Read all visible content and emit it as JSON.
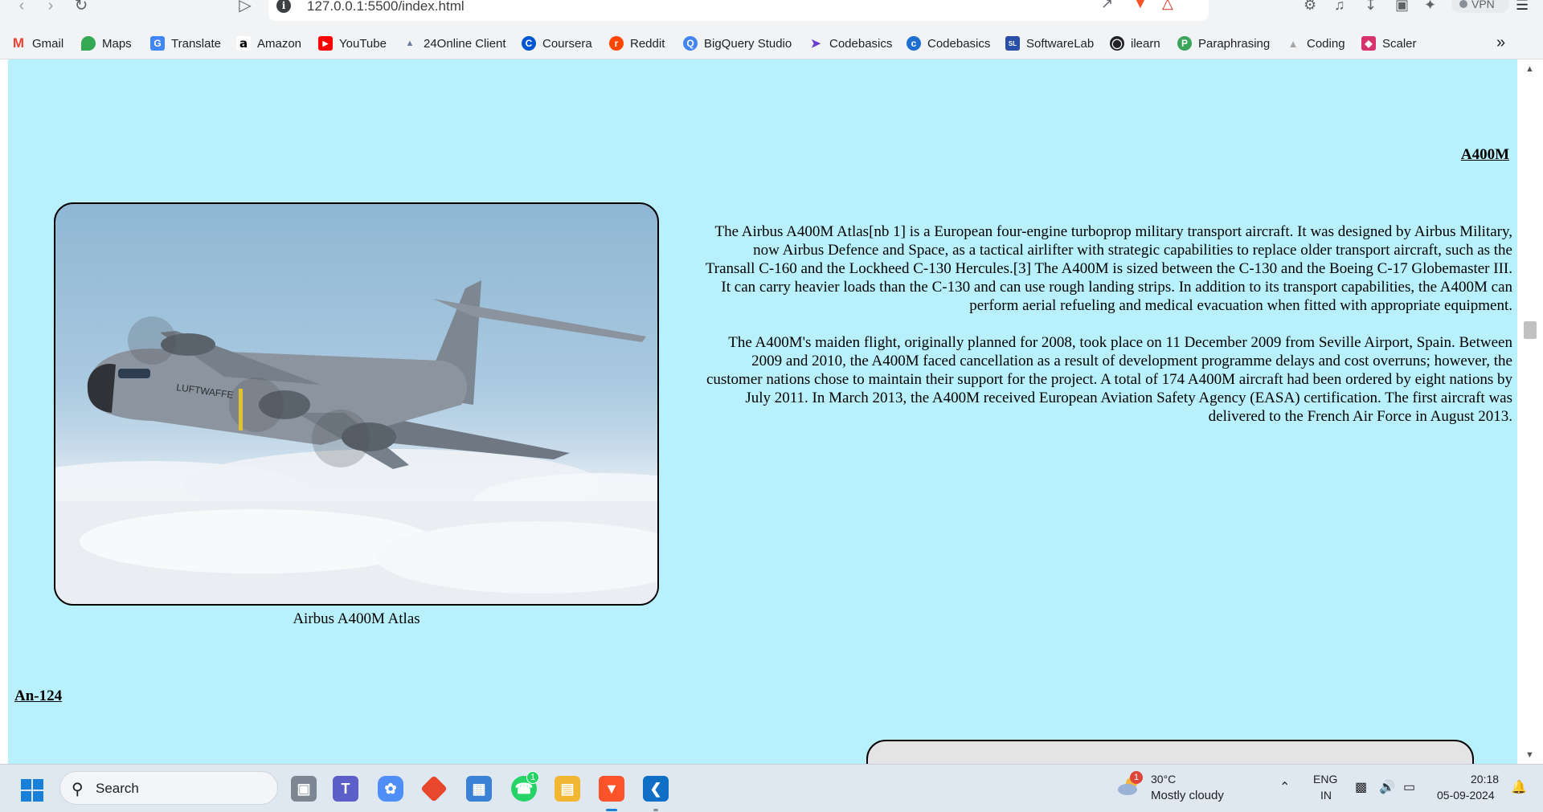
{
  "browser": {
    "url": "127.0.0.1:5500/index.html",
    "vpn_label": "VPN",
    "bookmarks": [
      {
        "label": "Gmail",
        "icon": "gmail-icon",
        "color": "#ea4335"
      },
      {
        "label": "Maps",
        "icon": "maps-icon",
        "color": "#34a853"
      },
      {
        "label": "Translate",
        "icon": "translate-icon",
        "color": "#4285f4"
      },
      {
        "label": "Amazon",
        "icon": "amazon-icon",
        "color": "#000000"
      },
      {
        "label": "YouTube",
        "icon": "youtube-icon",
        "color": "#ff0000"
      },
      {
        "label": "24Online Client",
        "icon": "online-client-icon",
        "color": "#6b7aa1"
      },
      {
        "label": "Coursera",
        "icon": "coursera-icon",
        "color": "#0056d2"
      },
      {
        "label": "Reddit",
        "icon": "reddit-icon",
        "color": "#ff4500"
      },
      {
        "label": "BigQuery Studio",
        "icon": "bigquery-icon",
        "color": "#4285f4"
      },
      {
        "label": "Codebasics",
        "icon": "rocket-icon",
        "color": "#6c3ccf"
      },
      {
        "label": "Codebasics",
        "icon": "codebasics-icon",
        "color": "#1f6fd1"
      },
      {
        "label": "SoftwareLab",
        "icon": "softwarelab-icon",
        "color": "#2a4fa8"
      },
      {
        "label": "ilearn",
        "icon": "globe-icon",
        "color": "#202124"
      },
      {
        "label": "Paraphrasing",
        "icon": "paraphrasing-icon",
        "color": "#3aa55a"
      },
      {
        "label": "Coding",
        "icon": "coding-icon",
        "color": "#a5a5a5"
      },
      {
        "label": "Scaler",
        "icon": "scaler-icon",
        "color": "#d6336c"
      }
    ]
  },
  "page": {
    "background": "#b8f1fc",
    "section_a400m": {
      "title": "A400M",
      "caption": "Airbus A400M Atlas",
      "paragraphs": [
        "The Airbus A400M Atlas[nb 1] is a European four-engine turboprop military transport aircraft. It was designed by Airbus Military, now Airbus Defence and Space, as a tactical airlifter with strategic capabilities to replace older transport aircraft, such as the Transall C-160 and the Lockheed C-130 Hercules.[3] The A400M is sized between the C-130 and the Boeing C-17 Globemaster III. It can carry heavier loads than the C-130 and can use rough landing strips. In addition to its transport capabilities, the A400M can perform aerial refueling and medical evacuation when fitted with appropriate equipment.",
        "The A400M's maiden flight, originally planned for 2008, took place on 11 December 2009 from Seville Airport, Spain. Between 2009 and 2010, the A400M faced cancellation as a result of development programme delays and cost overruns; however, the customer nations chose to maintain their support for the project. A total of 174 A400M aircraft had been ordered by eight nations by July 2011. In March 2013, the A400M received European Aviation Safety Agency (EASA) certification. The first aircraft was delivered to the French Air Force in August 2013."
      ],
      "fuselage_marking": "LUFTWAFFE"
    },
    "section_an124": {
      "title": "An-124"
    }
  },
  "taskbar": {
    "search_label": "Search",
    "weather_badge": "1",
    "weather_temp": "30°C",
    "weather_condition": "Mostly cloudy",
    "whatsapp_badge": "1",
    "language_top": "ENG",
    "language_bottom": "IN",
    "time": "20:18",
    "date": "05-09-2024"
  }
}
